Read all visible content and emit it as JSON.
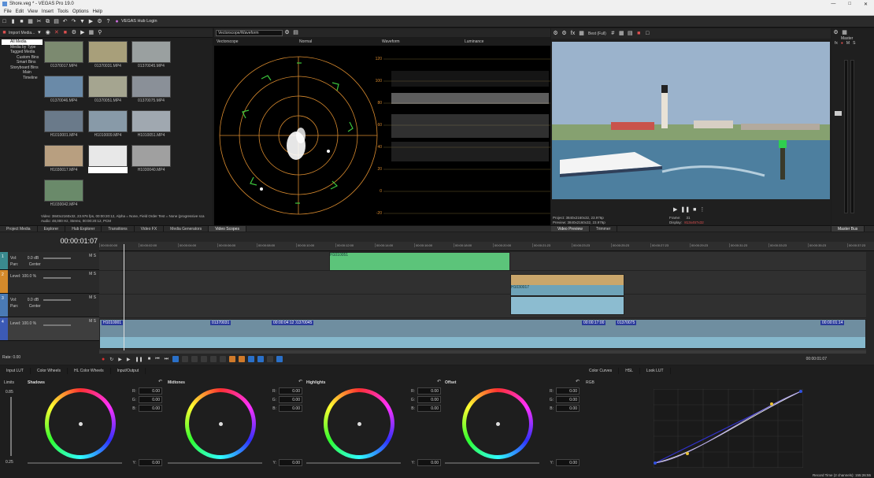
{
  "window": {
    "title": "Shore.veg * - VEGAS Pro 19.0"
  },
  "menu": [
    "File",
    "Edit",
    "View",
    "Insert",
    "Tools",
    "Options",
    "Help"
  ],
  "toolbar": {
    "hub_login": "VEGAS Hub Login"
  },
  "project_media": {
    "import_label": "Import Media...",
    "tree": [
      "All Media",
      "Media by Type",
      "Tagged Media",
      "Custom Bins",
      "Smart Bins",
      "Storyboard Bins",
      "Main Timeline"
    ],
    "thumbs": [
      "01370017.MP4",
      "01370031.MP4",
      "01370045.MP4",
      "01370046.MP4",
      "01370051.MP4",
      "01370075.MP4",
      "H1010001.MP4",
      "H1010009.MP4",
      "H1010051.MP4",
      "H1030017.MP4",
      "",
      "H1030040.MP4",
      "H1030042.MP4"
    ],
    "info_line1": "Video: 3840x2160x32, 23.976 fps, 00:00:20:12, Alpha = None, Field Order Test = None (progressive sca",
    "info_line2": "Audio: 48,000 Hz, Stereo, 00:00:20:12, PCM"
  },
  "scopes": {
    "dropdown": "Vectorscope/Waveform",
    "vectorscope_label": "Vectorscope",
    "mode": "Normal",
    "waveform_label": "Waveform",
    "luminance": "Luminance",
    "ticks": [
      "120",
      "100",
      "80",
      "60",
      "40",
      "20",
      "0",
      "-20"
    ]
  },
  "preview": {
    "quality": "Best (Full)",
    "project": "Project:  3840x2160x32, 23.976p",
    "preview_res": "Preview:  3840x2160x32, 23.976p",
    "frame_label": "Frame:",
    "frame_value": "31",
    "display_label": "Display:",
    "display_value": "813x457x32"
  },
  "master": {
    "label": "Master",
    "tab": "Master Bus"
  },
  "upper_tabs": [
    "Project Media",
    "Explorer",
    "Hub Explorer",
    "Transitions",
    "Video FX",
    "Media Generators",
    "Video Scopes"
  ],
  "preview_tabs": [
    "Video Preview",
    "Trimmer"
  ],
  "timecode": "00:00:01:07",
  "ruler": [
    "00:00:00:00",
    "00:00:02:00",
    "00:00:04:00",
    "00:00:06:00",
    "00:00:08:00",
    "00:00:10:00",
    "00:00:12:00",
    "00:00:14:00",
    "00:00:16:00",
    "00:00:18:00",
    "00:00:20:00",
    "00:00:21:23",
    "00:00:23:23",
    "00:00:25:23",
    "00:00:27:23",
    "00:00:29:23",
    "00:00:31:23",
    "00:00:33:23",
    "00:00:35:23",
    "00:00:37:23"
  ],
  "tracks": [
    {
      "n": "1",
      "line1": "Vol:",
      "v1": "0.0 dB",
      "line2": "Pan:",
      "v2": "Center",
      "color": "#3a8a8f"
    },
    {
      "n": "2",
      "line1": "Level: 100.0 %",
      "v1": "",
      "line2": "",
      "v2": "",
      "color": "#d48a2b"
    },
    {
      "n": "3",
      "line1": "Vol:",
      "v1": "0.0 dB",
      "line2": "Pan:",
      "v2": "Center",
      "color": "#4a7ab5"
    },
    {
      "n": "4",
      "line1": "Level: 100.0 %",
      "v1": "",
      "line2": "",
      "v2": "",
      "color": "#3c5ab5"
    }
  ],
  "clips": {
    "c1": "H1010051",
    "c2": "H1030017",
    "c3": "H1010001",
    "c4": "01370031",
    "c5": "01370045",
    "c6": "01370075",
    "tc1": "00:00:04:12",
    "tc2": "00:00:17:00",
    "tc3": "00:00:01:14"
  },
  "rate": "Rate: 0.00",
  "transport_time": "00:00:01:07",
  "grading": {
    "tabs": [
      "Input LUT",
      "Color Wheels",
      "HL Color Wheels",
      "Input/Output"
    ],
    "limits": "Limits",
    "limit_top": "0.85",
    "limit_bot": "0.25",
    "wheels": [
      {
        "name": "Shadows",
        "r": "0.00",
        "g": "0.00",
        "b": "0.00",
        "y": "0.00"
      },
      {
        "name": "Midtones",
        "r": "0.00",
        "g": "0.00",
        "b": "0.00",
        "y": "0.00"
      },
      {
        "name": "Highlights",
        "r": "0.00",
        "g": "0.00",
        "b": "0.00",
        "y": "0.00"
      },
      {
        "name": "Offset",
        "r": "0.00",
        "g": "0.00",
        "b": "0.00",
        "y": "0.00"
      }
    ],
    "labels": {
      "r": "R:",
      "g": "G:",
      "b": "B:",
      "y": "Y:"
    },
    "curve_tabs": [
      "Color Curves",
      "HSL",
      "Look LUT"
    ],
    "curve_channel": "RGB"
  },
  "status": "Record Time (2 channels): 155:26:55"
}
